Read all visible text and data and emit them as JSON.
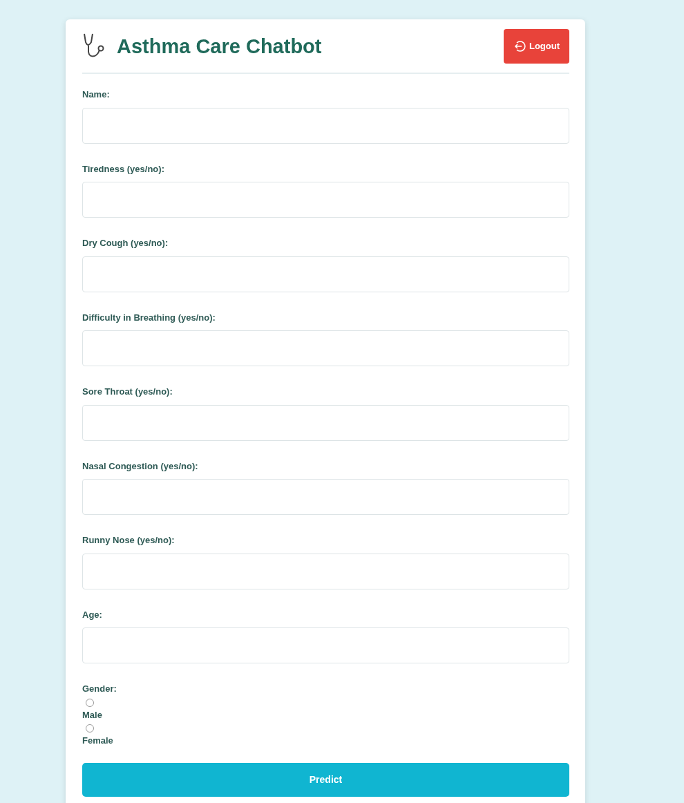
{
  "header": {
    "title": "Asthma Care Chatbot",
    "logout_button": "Logout"
  },
  "fields": [
    {
      "label": "Name:"
    },
    {
      "label": "Tiredness (yes/no):"
    },
    {
      "label": "Dry Cough (yes/no):"
    },
    {
      "label": "Difficulty in Breathing (yes/no):"
    },
    {
      "label": "Sore Throat (yes/no):"
    },
    {
      "label": "Nasal Congestion (yes/no):"
    },
    {
      "label": "Runny Nose (yes/no):"
    },
    {
      "label": "Age:"
    }
  ],
  "gender": {
    "label": "Gender:",
    "options": [
      {
        "label": "Male",
        "selected": false
      },
      {
        "label": "Female",
        "selected": false
      }
    ]
  },
  "submit_button": "Predict"
}
